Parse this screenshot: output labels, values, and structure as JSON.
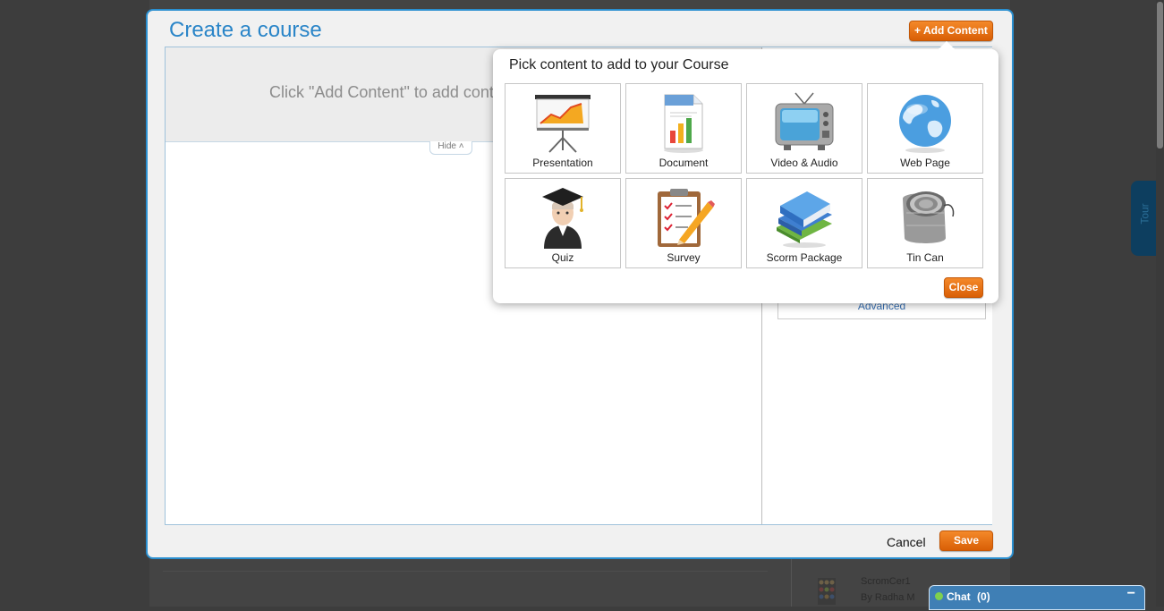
{
  "modal": {
    "title": "Create a course",
    "add_content_label": "+ Add Content",
    "placeholder": "Click \"Add Content\" to add cont",
    "hide_label": "Hide",
    "hide_icon": "chevron-up-double",
    "advanced_label": "Advanced",
    "cancel_label": "Cancel",
    "save_label": "Save"
  },
  "popup": {
    "title": "Pick content to add to your Course",
    "items": [
      {
        "label": "Presentation",
        "icon": "presentation-icon"
      },
      {
        "label": "Document",
        "icon": "document-icon"
      },
      {
        "label": "Video & Audio",
        "icon": "tv-icon"
      },
      {
        "label": "Web Page",
        "icon": "globe-icon"
      },
      {
        "label": "Quiz",
        "icon": "graduate-icon"
      },
      {
        "label": "Survey",
        "icon": "clipboard-icon"
      },
      {
        "label": "Scorm Package",
        "icon": "books-icon"
      },
      {
        "label": "Tin Can",
        "icon": "tin-can-icon"
      }
    ],
    "close_label": "Close"
  },
  "background": {
    "course_title": "ScromCer1",
    "course_author": "By Radha M",
    "tour_label": "Tour"
  },
  "chat": {
    "label": "Chat",
    "count": "(0)",
    "minimize": "−"
  },
  "colors": {
    "accent_blue": "#2a85c8",
    "button_orange": "#e8720f",
    "chat_blue": "#3f7fb5"
  }
}
